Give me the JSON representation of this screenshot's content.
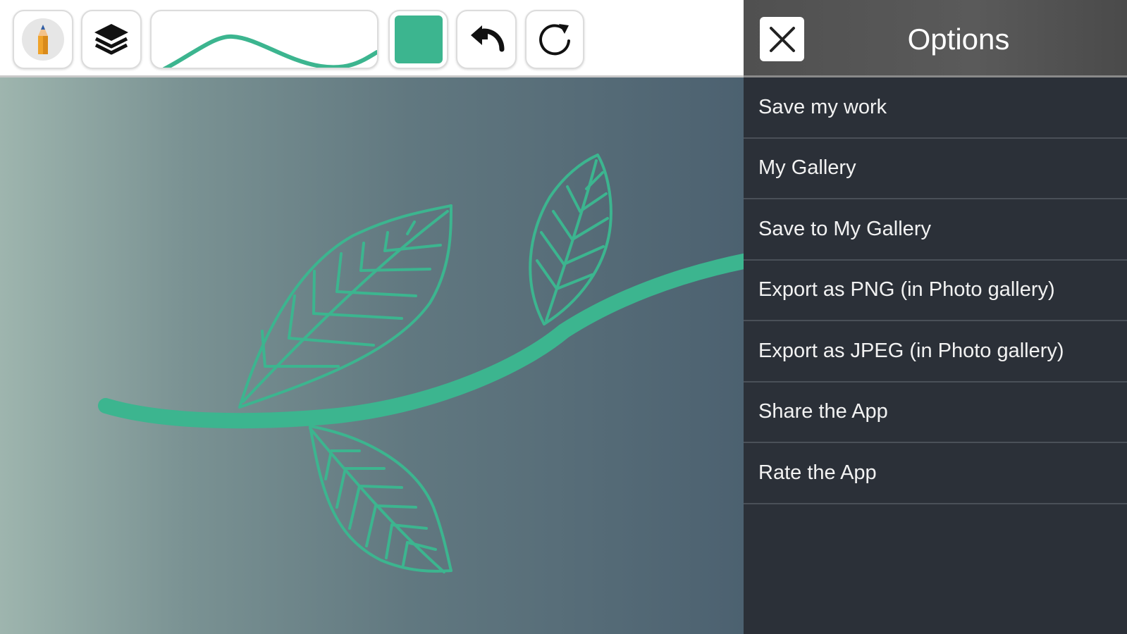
{
  "toolbar": {
    "brush_icon": "pencil-icon",
    "layers_icon": "layers-icon",
    "stroke_preview_icon": "stroke-preview-icon",
    "color_swatch": "#3cb58f",
    "undo_icon": "undo-icon",
    "redo_icon": "redo-icon"
  },
  "canvas": {
    "gradient_start": "#9eb5ae",
    "gradient_end": "#4c6170",
    "stroke_color": "#3cb58f"
  },
  "options": {
    "title": "Options",
    "close_icon": "close-icon",
    "items": [
      {
        "label": "Save my work"
      },
      {
        "label": "My Gallery"
      },
      {
        "label": "Save to My Gallery"
      },
      {
        "label": "Export as PNG (in Photo gallery)"
      },
      {
        "label": "Export as JPEG (in Photo gallery)"
      },
      {
        "label": "Share the App"
      },
      {
        "label": "Rate the App"
      }
    ]
  }
}
